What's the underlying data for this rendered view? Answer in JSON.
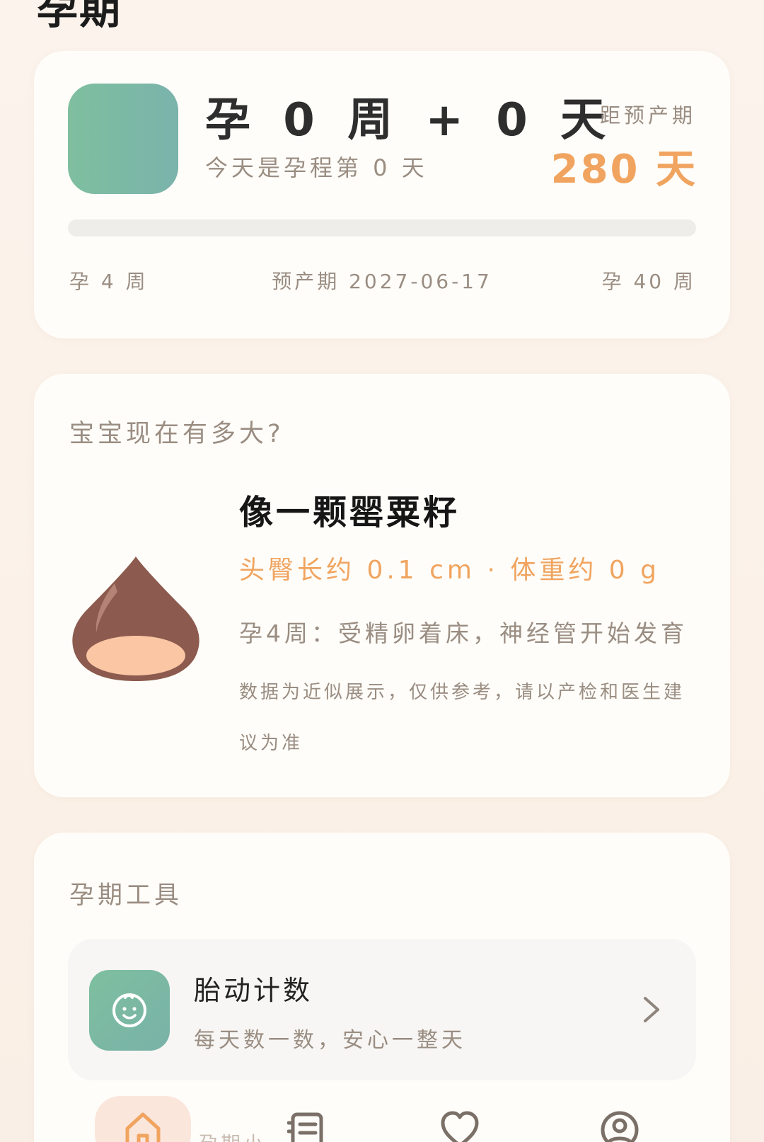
{
  "page": {
    "title": "孕期"
  },
  "progress": {
    "main": "孕 0 周 + 0 天",
    "sub": "今天是孕程第 0 天",
    "due_label": "距预产期",
    "due_value": "280 天",
    "fill_fraction": 0,
    "scale_start": "孕 4 周",
    "scale_mid": "预产期 2027-06-17",
    "scale_end": "孕 40 周"
  },
  "size": {
    "title": "宝宝现在有多大?",
    "fruit_icon": "chestnut-icon",
    "name": "像一颗罂粟籽",
    "measure": "头臀长约 0.1 cm · 体重约 0 g",
    "desc": "孕4周：受精卵着床，神经管开始发育",
    "note": "数据为近似展示，仅供参考，请以产检和医生建议为准"
  },
  "tools": {
    "title": "孕期工具",
    "items": [
      {
        "icon": "baby-face-icon",
        "title": "胎动计数",
        "sub": "每天数一数，安心一整天"
      }
    ]
  },
  "tabbar": {
    "partial_label": "孕期小",
    "tabs": [
      {
        "icon": "home-icon"
      },
      {
        "icon": "list-icon"
      },
      {
        "icon": "heart-icon"
      },
      {
        "icon": "profile-icon"
      }
    ]
  },
  "colors": {
    "accent": "#f0a45f",
    "green": "#7fbf9f",
    "brown": "#8c5a4e",
    "muted": "#9a8d82"
  }
}
